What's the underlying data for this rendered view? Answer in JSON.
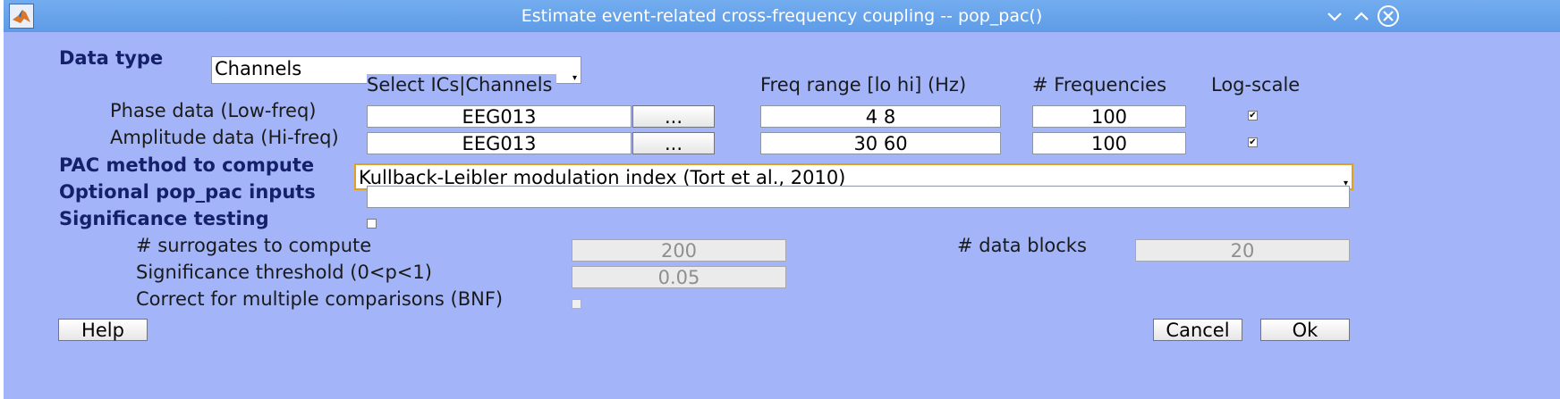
{
  "window": {
    "title": "Estimate event-related cross-frequency coupling -- pop_pac()",
    "app_icon": "matlab-logo-icon",
    "controls": [
      "minimize-icon",
      "maximize-icon",
      "close-icon"
    ]
  },
  "data_type": {
    "label": "Data type",
    "selected": "Channels"
  },
  "columns": {
    "select": "Select ICs|Channels",
    "freq_range": "Freq range [lo hi] (Hz)",
    "num_freqs": "# Frequencies",
    "log_scale": "Log-scale"
  },
  "phase": {
    "label": "Phase data (Low-freq)",
    "channel": "EEG013",
    "browse": "...",
    "freq_range": "4  8",
    "num_freqs": "100",
    "log_scale": true
  },
  "amplitude": {
    "label": "Amplitude data (Hi-freq)",
    "channel": "EEG013",
    "browse": "...",
    "freq_range": "30  60",
    "num_freqs": "100",
    "log_scale": true
  },
  "pac_method": {
    "label": "PAC method to compute",
    "selected": "Kullback-Leibler modulation index (Tort et al., 2010)"
  },
  "optional_inputs": {
    "label": "Optional pop_pac inputs",
    "value": ""
  },
  "significance": {
    "label": "Significance testing",
    "enabled": false,
    "surrogates_label": "# surrogates to compute",
    "surrogates_value": "200",
    "data_blocks_label": "# data blocks",
    "data_blocks_value": "20",
    "threshold_label": "Significance threshold (0<p<1)",
    "threshold_value": "0.05",
    "bnf_label": "Correct for multiple comparisons (BNF)",
    "bnf_checked": false
  },
  "buttons": {
    "help": "Help",
    "cancel": "Cancel",
    "ok": "Ok"
  },
  "colors": {
    "background": "#a3b5f8",
    "titlebar": "#6aa4ea",
    "bold_label": "#15206b"
  }
}
